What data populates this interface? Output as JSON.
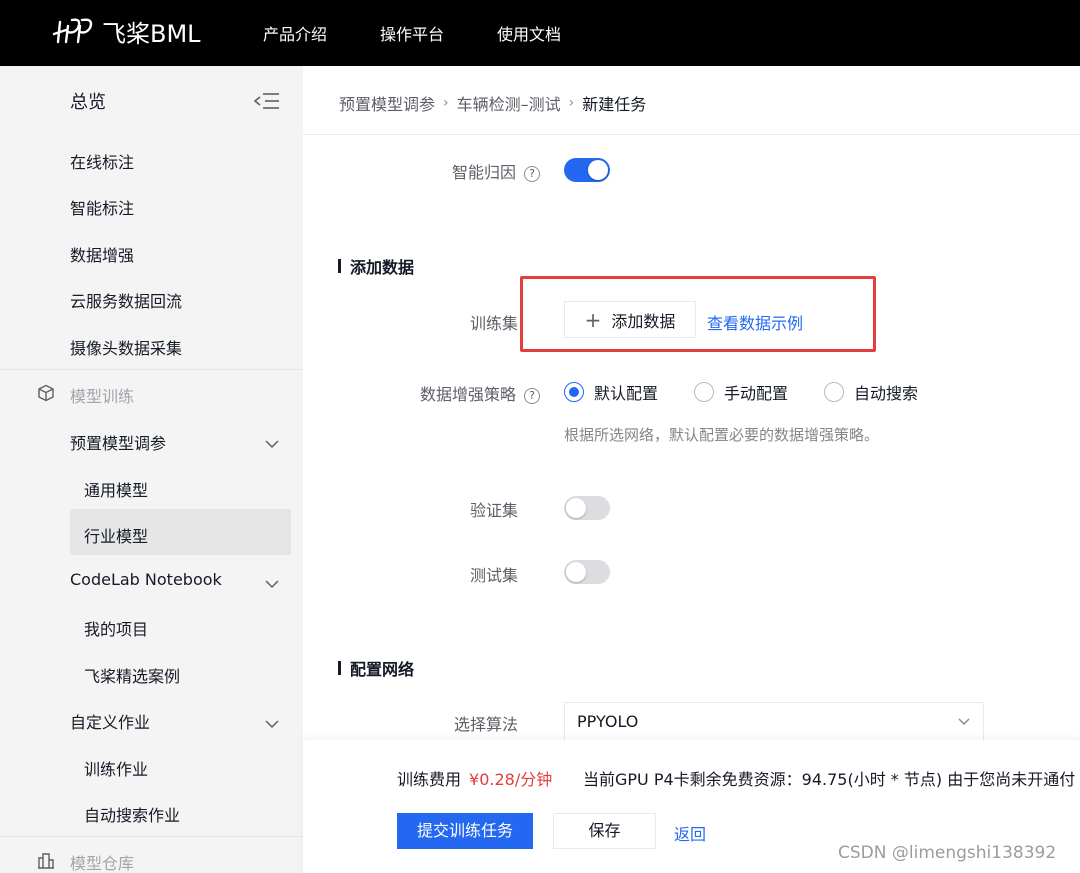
{
  "header": {
    "logo_text": "飞桨BML",
    "nav": [
      "产品介绍",
      "操作平台",
      "使用文档"
    ]
  },
  "sidebar": {
    "overview": "总览",
    "items": {
      "online_label": "在线标注",
      "smart_label": "智能标注",
      "data_aug": "数据增强",
      "cloud_backflow": "云服务数据回流",
      "camera_collect": "摄像头数据采集",
      "model_training": "模型训练",
      "preset_tuning": "预置模型调参",
      "general_model": "通用模型",
      "industry_model": "行业模型",
      "codelab": "CodeLab Notebook",
      "my_projects": "我的项目",
      "paddle_cases": "飞桨精选案例",
      "custom_jobs": "自定义作业",
      "training_jobs": "训练作业",
      "auto_search_jobs": "自动搜索作业",
      "model_repo": "模型仓库"
    }
  },
  "breadcrumb": {
    "level1": "预置模型调参",
    "level2": "车辆检测–测试",
    "current": "新建任务"
  },
  "form": {
    "smart_attribution": {
      "label": "智能归因",
      "enabled": true
    },
    "add_data_section": "添加数据",
    "training_set": {
      "label": "训练集",
      "add_button": "添加数据",
      "example_link": "查看数据示例"
    },
    "augmentation": {
      "label": "数据增强策略",
      "options": [
        "默认配置",
        "手动配置",
        "自动搜索"
      ],
      "selected": "默认配置",
      "hint": "根据所选网络，默认配置必要的数据增强策略。"
    },
    "validation_set": {
      "label": "验证集",
      "enabled": false
    },
    "test_set": {
      "label": "测试集",
      "enabled": false
    },
    "network_section": "配置网络",
    "algorithm": {
      "label": "选择算法",
      "value": "PPYOLO"
    }
  },
  "footer": {
    "fee_label": "训练费用",
    "fee_value": "¥0.28/分钟",
    "gpu_info": "当前GPU P4卡剩余免费资源：94.75(小时 * 节点) 由于您尚未开通付",
    "submit": "提交训练任务",
    "save": "保存",
    "back": "返回"
  },
  "watermark": "CSDN @limengshi138392",
  "colors": {
    "primary": "#2468f2",
    "danger": "#e33e3e",
    "topbar": "#000000",
    "sidebar_bg": "#f4f4f4"
  }
}
